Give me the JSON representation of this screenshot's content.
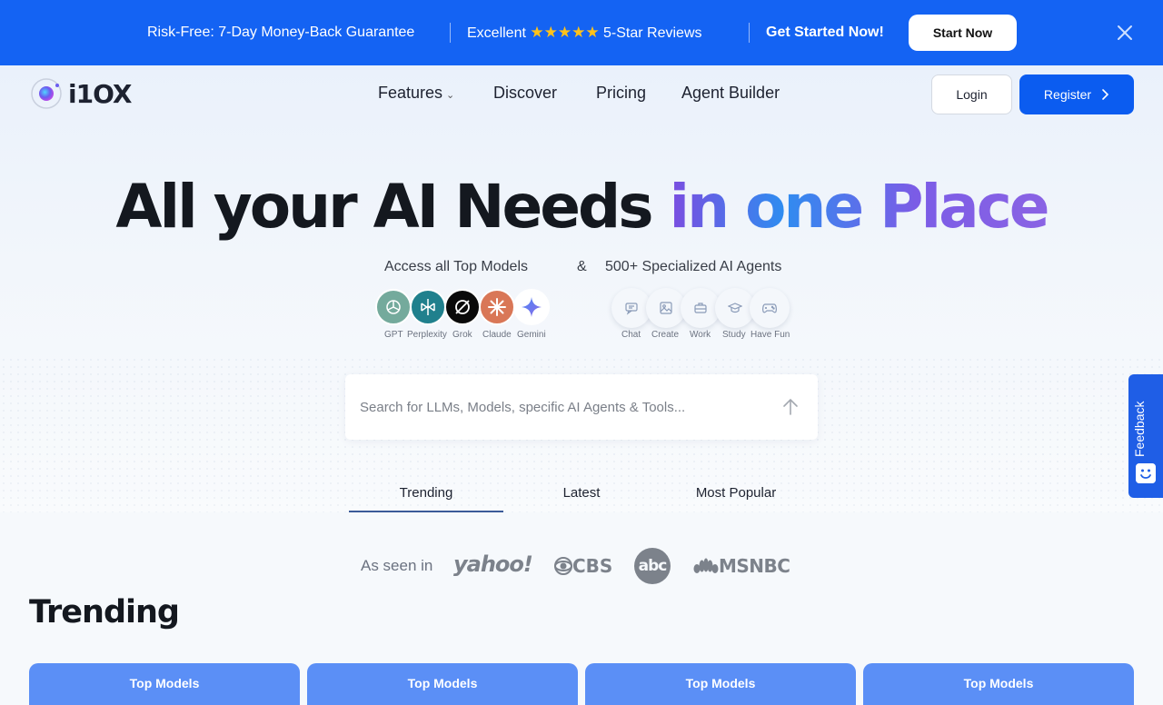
{
  "promo": {
    "guarantee": "Risk-Free: 7-Day Money-Back Guarantee",
    "excellent": "Excellent",
    "stars": "★★★★★",
    "reviews": "5-Star Reviews",
    "cta_text": "Get Started Now!",
    "start_button": "Start Now"
  },
  "header": {
    "logo_text": "i1OX",
    "nav": [
      "Features",
      "Discover",
      "Pricing",
      "Agent Builder"
    ],
    "login": "Login",
    "register": "Register"
  },
  "hero": {
    "headline_plain": "All your AI Needs",
    "headline_gradient": "in one Place",
    "sub_models": "Access all Top Models",
    "sub_amp": "&",
    "sub_agents": "500+ Specialized AI Agents",
    "models": [
      "GPT",
      "Perplexity",
      "Grok",
      "Claude",
      "Gemini"
    ],
    "agents": [
      "Chat",
      "Create",
      "Work",
      "Study",
      "Have Fun"
    ]
  },
  "search": {
    "placeholder": "Search for LLMs, Models, specific AI Agents & Tools..."
  },
  "tabs": [
    "Trending",
    "Latest",
    "Most Popular"
  ],
  "active_tab": "Trending",
  "feedback": "Feedback",
  "press": {
    "label": "As seen in",
    "outlets": [
      "yahoo!",
      "CBS",
      "abc",
      "MSNBC"
    ]
  },
  "section_title": "Trending",
  "cards": [
    "Top Models",
    "Top Models",
    "Top Models",
    "Top Models"
  ],
  "colors": {
    "brand_blue": "#1463f3",
    "register_blue": "#0b5cf0",
    "star_yellow": "#ffc21a",
    "card_blue": "#5b8ff6"
  }
}
